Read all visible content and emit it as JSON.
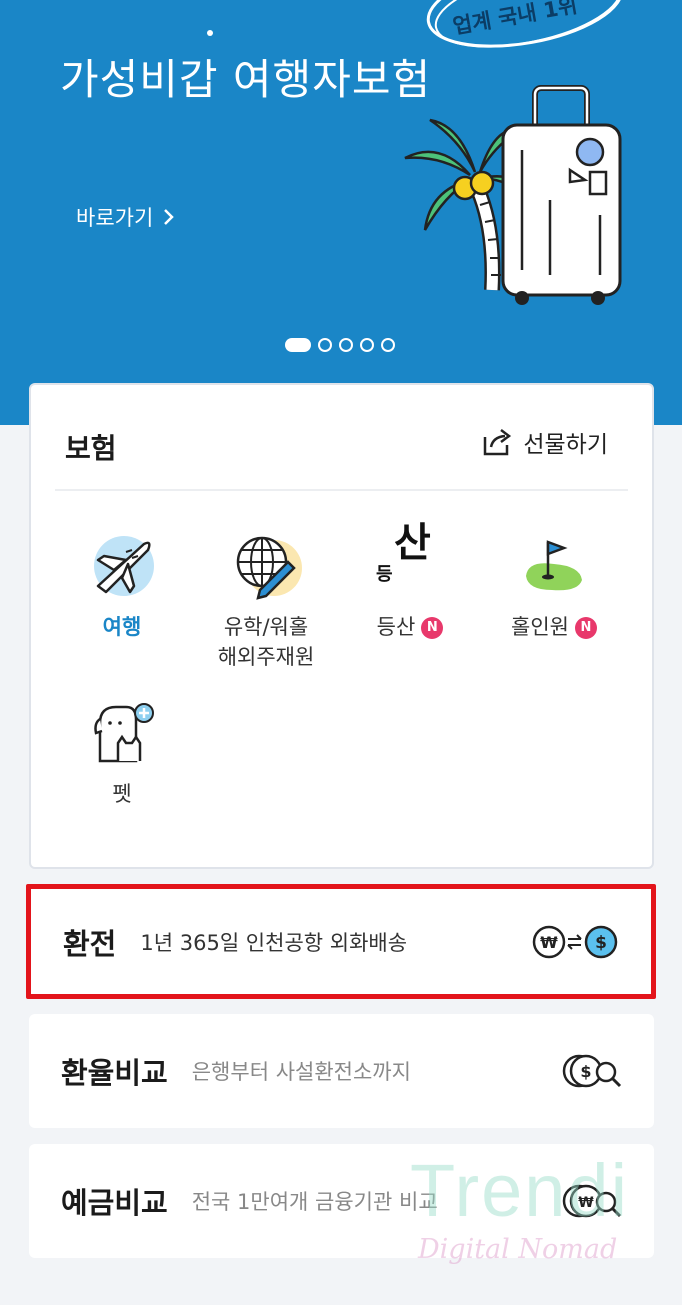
{
  "banner": {
    "title": "가성비갑 여행자보험",
    "link_label": "바로가기",
    "badge_text": "업계 국내 1위",
    "page_count": 5,
    "active_page": 1
  },
  "insurance": {
    "title": "보험",
    "gift_label": "선물하기",
    "items": [
      {
        "label": "여행",
        "label2": "",
        "icon": "airplane-icon",
        "active": true,
        "new": false
      },
      {
        "label": "유학/워홀",
        "label2": "해외주재원",
        "icon": "globe-pen-icon",
        "active": false,
        "new": false
      },
      {
        "label": "등산",
        "label2": "",
        "icon": "mountain-text-icon",
        "active": false,
        "new": true
      },
      {
        "label": "홀인원",
        "label2": "",
        "icon": "golf-flag-icon",
        "active": false,
        "new": true
      },
      {
        "label": "펫",
        "label2": "",
        "icon": "pet-icon",
        "active": false,
        "new": false
      }
    ],
    "new_badge": "N",
    "mountain_glyph_small": "등",
    "mountain_glyph_big": "산"
  },
  "exchange": {
    "title": "환전",
    "desc": "1년 365일 인천공항 외화배송",
    "icon": "won-to-dollar-icon"
  },
  "rate_compare": {
    "title": "환율비교",
    "desc": "은행부터 사설환전소까지",
    "icon": "coin-search-icon"
  },
  "deposit_compare": {
    "title": "예금비교",
    "desc": "전국 1만여개 금융기관 비교",
    "icon": "won-search-icon"
  },
  "watermark": {
    "main": "Trendi",
    "sub": "Digital Nomad"
  },
  "colors": {
    "banner_bg": "#1a86c7",
    "accent": "#1a86c7",
    "new_badge": "#e8386b",
    "highlight_border": "#e3141b"
  }
}
